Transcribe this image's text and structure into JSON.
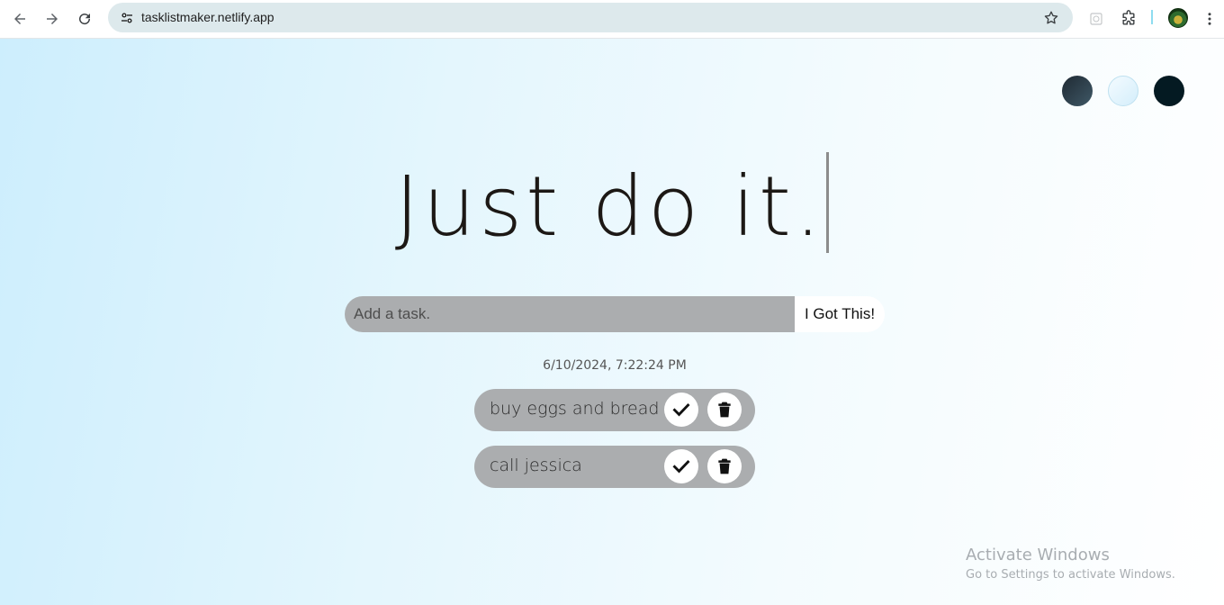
{
  "browser": {
    "url": "tasklistmaker.netlify.app",
    "icons": [
      "back-arrow-icon",
      "forward-arrow-icon",
      "reload-icon",
      "site-info-icon",
      "bookmark-star-icon",
      "extension-icon",
      "puzzle-icon",
      "profile-avatar",
      "more-icon"
    ]
  },
  "theme": {
    "options": [
      "dark-gray",
      "light",
      "black"
    ],
    "colors": {
      "dark_gray": "#2f404b",
      "light": "#e6f6fd",
      "black": "#041a22"
    }
  },
  "headline": "Just do it.",
  "form": {
    "placeholder": "Add a task.",
    "button_label": "I Got This!"
  },
  "datetime": "6/10/2024, 7:22:24 PM",
  "tasks": [
    {
      "text": "buy eggs and bread"
    },
    {
      "text": "call jessica"
    }
  ],
  "watermark": {
    "title": "Activate Windows",
    "subtitle": "Go to Settings to activate Windows."
  },
  "colors": {
    "task_bg": "#abadaf",
    "page_gradient_start": "#cdeefd",
    "page_gradient_end": "#ffffff"
  }
}
